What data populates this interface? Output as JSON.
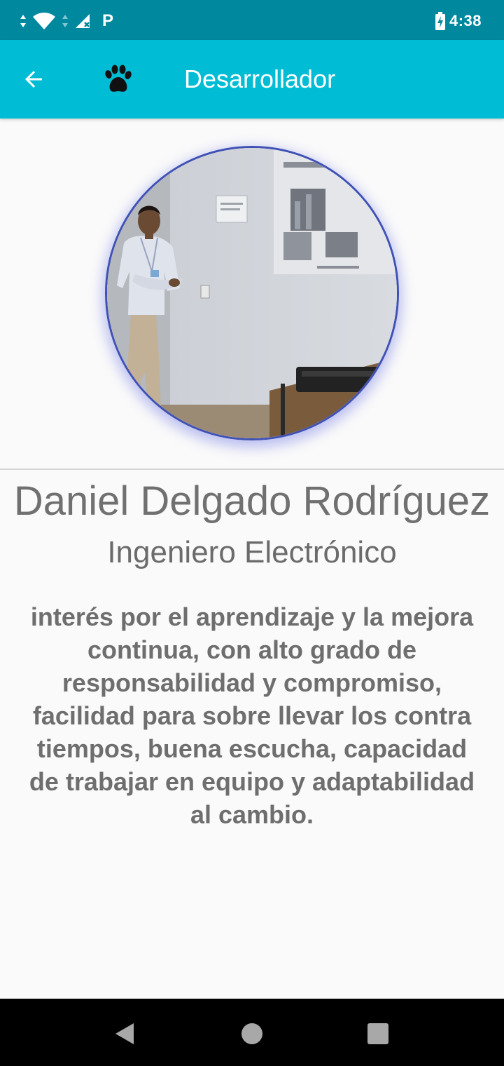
{
  "status_bar": {
    "time": "4:38",
    "parking_glyph": "P",
    "icons": [
      "data-arrows-icon",
      "wifi-icon",
      "signal-arrows-icon",
      "cell-signal-no-service-icon",
      "parking-app-icon",
      "battery-charging-icon"
    ]
  },
  "app_bar": {
    "title": "Desarrollador",
    "back_icon": "arrow-back-icon",
    "logo_icon": "paw-icon",
    "color": "#00bcd4"
  },
  "profile": {
    "name": "Daniel Delgado Rodríguez",
    "role": "Ingeniero Electrónico",
    "bio": "interés por el aprendizaje y la mejora continua, con alto grado de responsabilidad y compromiso, facilidad para sobre llevar los contra tiempos, buena escucha, capacidad de trabajar en equipo y adaptabilidad al cambio.",
    "photo_border_color": "#3f51b5"
  },
  "nav_bar": {
    "buttons": [
      "back-triangle-icon",
      "home-circle-icon",
      "recents-square-icon"
    ]
  }
}
